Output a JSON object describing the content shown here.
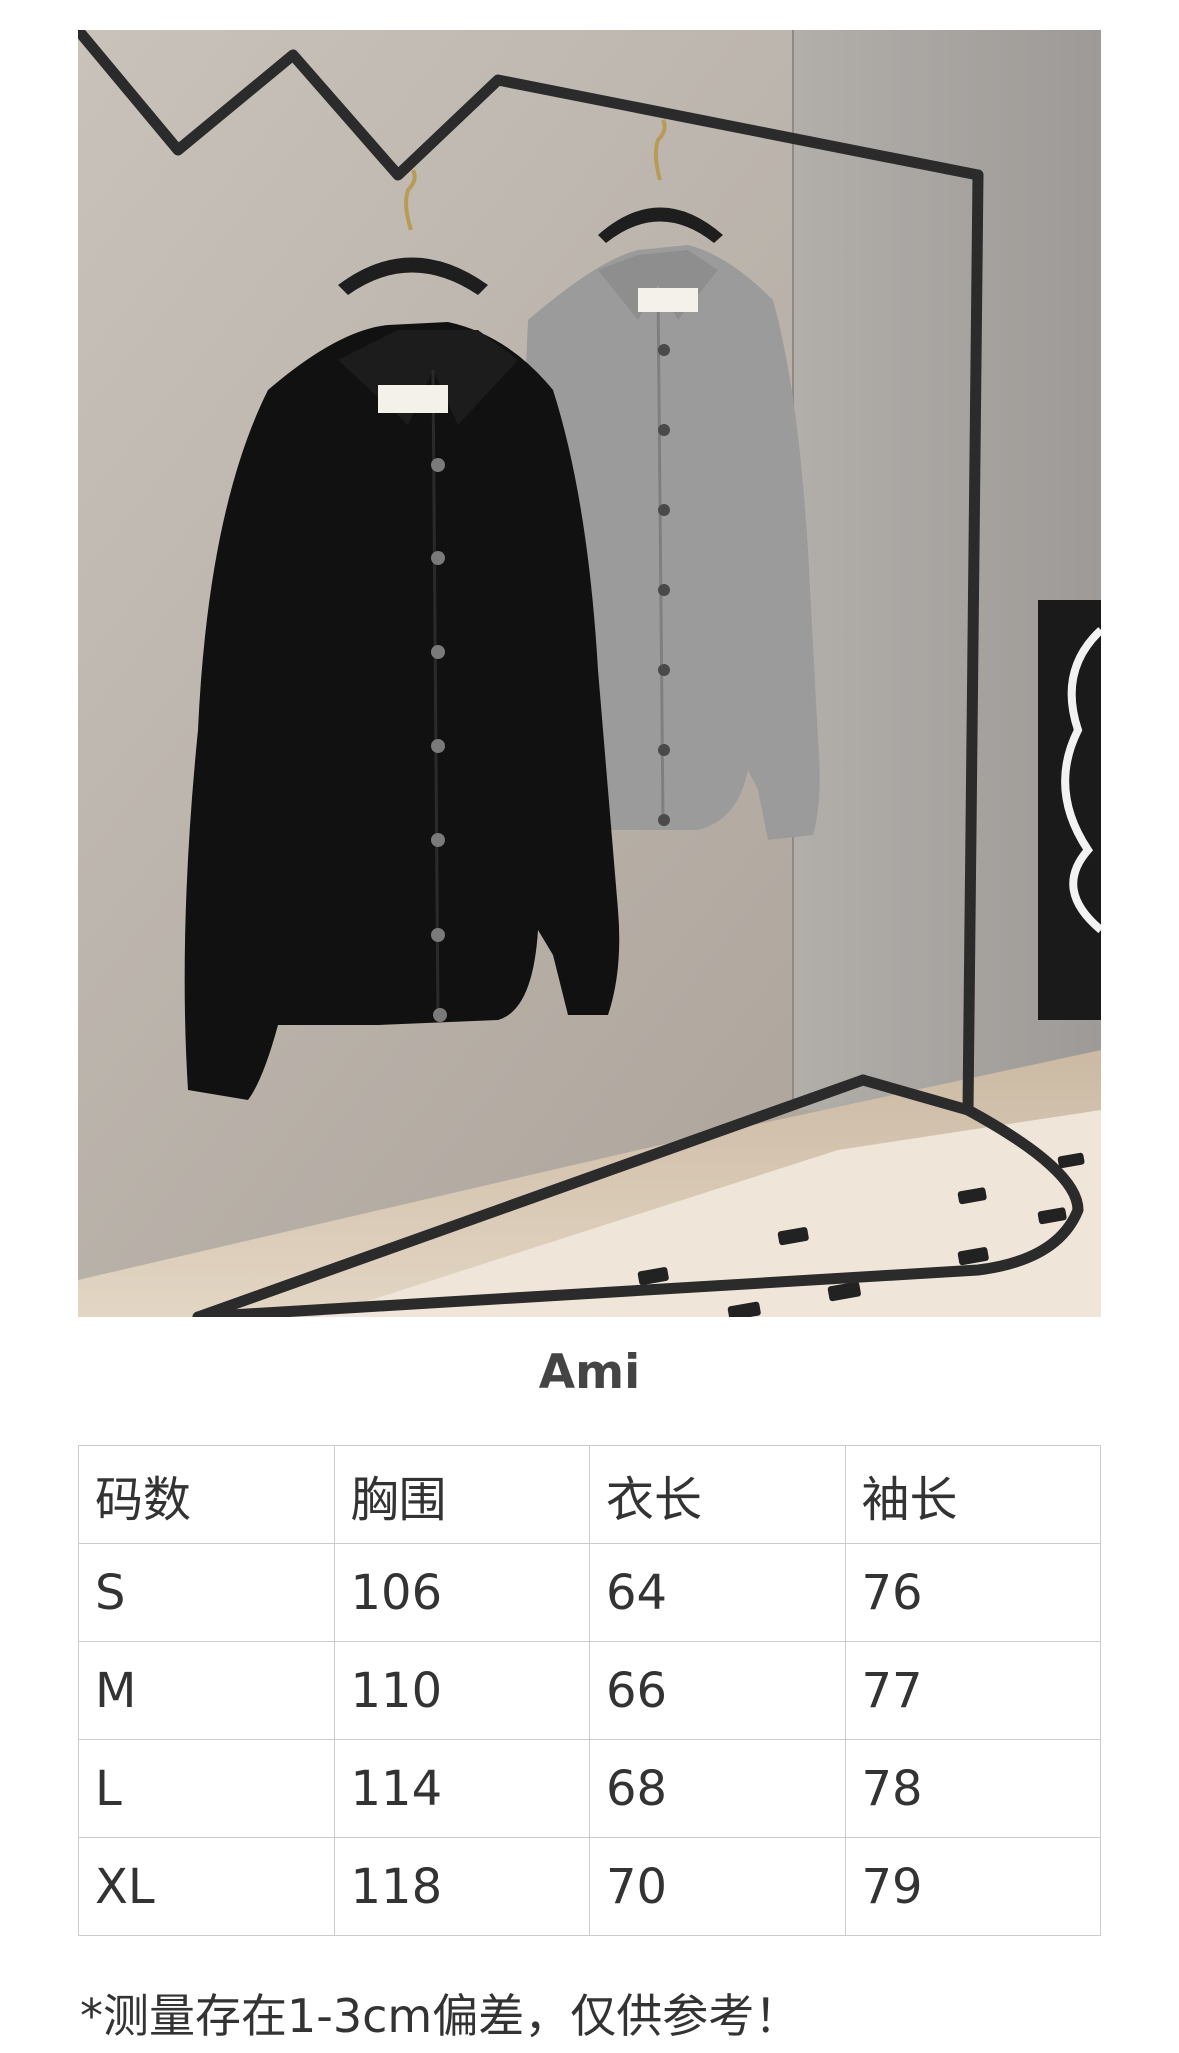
{
  "photo": {
    "alt_icon": "product-photo",
    "colors": {
      "wall_left": "#c9c3bc",
      "wall_right": "#a9a6a3",
      "floor": "#d8cab7",
      "rack": "#2a2a2a",
      "cardigan_black": "#111111",
      "cardigan_grey": "#9a9a9a"
    }
  },
  "brand": {
    "title": "Ami"
  },
  "size_table": {
    "headers": [
      "码数",
      "胸围",
      "衣长",
      "袖长"
    ],
    "rows": [
      [
        "S",
        "106",
        "64",
        "76"
      ],
      [
        "M",
        "110",
        "66",
        "77"
      ],
      [
        "L",
        "114",
        "68",
        "78"
      ],
      [
        "XL",
        "118",
        "70",
        "79"
      ]
    ]
  },
  "note": "*测量存在1-3cm偏差，仅供参考！"
}
